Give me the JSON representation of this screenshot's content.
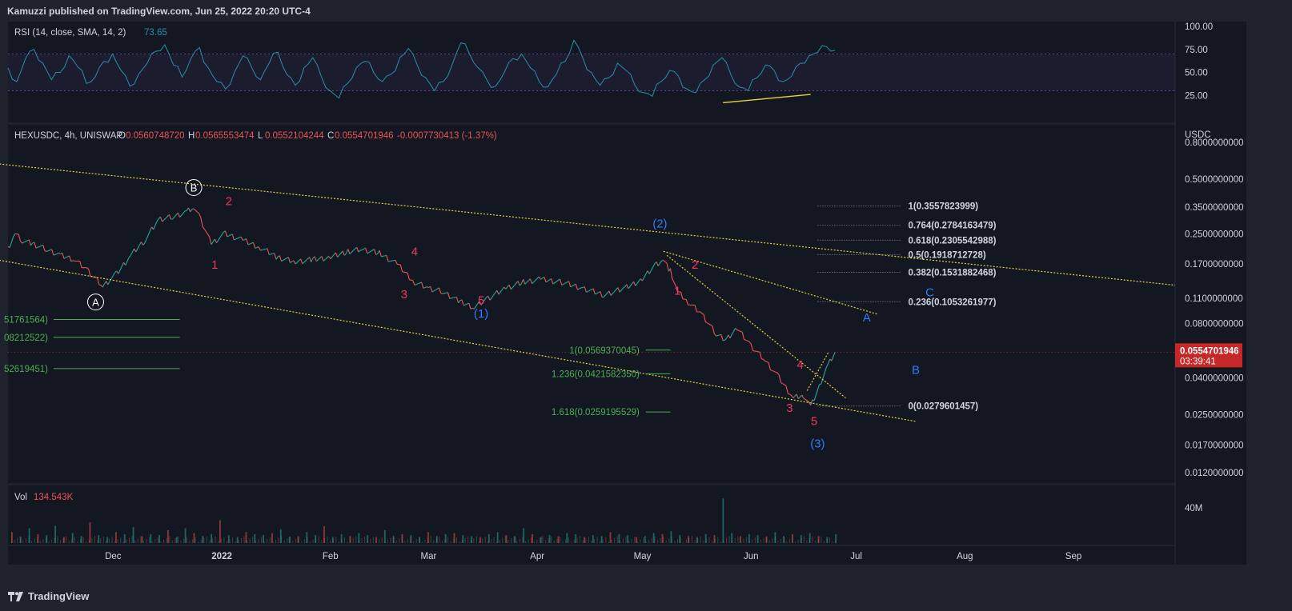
{
  "header": {
    "publisher_line": "Kamuzzi published on TradingView.com, Jun 25, 2022 20:20 UTC-4"
  },
  "footer": {
    "brand": "TradingView",
    "logo_icon": "tradingview-logo-icon"
  },
  "colors": {
    "background": "#131722",
    "frame": "#1e222d",
    "text": "#d1d4dc",
    "rsi_line": "#2a8fa8",
    "fib_green": "#4caf50",
    "wave_red": "#f23661",
    "wave_blue": "#2f7cf6",
    "trend_yellow": "#e8d237",
    "price_badge": "#c62828",
    "vol_up": "#26a69a",
    "vol_down": "#ef5350"
  },
  "rsi_panel": {
    "legend_name": "RSI (14, close, SMA, 14, 2)",
    "legend_value": "73.65",
    "axis_labels": [
      "100.00",
      "75.00",
      "50.00",
      "25.00"
    ]
  },
  "price_panel": {
    "legend": {
      "symbol": "HEXUSDC, 4h, UNISWAP",
      "o_label": "O",
      "o_value": "0.0560748720",
      "h_label": "H",
      "h_value": "0.0565553474",
      "l_label": "L",
      "l_value": "0.0552104244",
      "c_label": "C",
      "c_value": "0.0554701946",
      "change": "-0.0007730413 (-1.37%)"
    },
    "currency": "USDC",
    "axis_labels": [
      "0.8000000000",
      "0.5000000000",
      "0.3500000000",
      "0.2500000000",
      "0.1700000000",
      "0.1100000000",
      "0.0800000000",
      "0.0400000000",
      "0.0250000000",
      "0.0170000000",
      "0.0120000000"
    ],
    "price_badge": {
      "price": "0.0554701946",
      "countdown": "03:39:41"
    },
    "fib_right": [
      "1(0.3557823999)",
      "0.764(0.2784163479)",
      "0.618(0.2305542988)",
      "0.5(0.1918712728)",
      "0.382(0.1531882468)",
      "0.236(0.1053261977)",
      "0(0.0279601457)"
    ],
    "fib_mid": [
      "1(0.0569370045)",
      "1.236(0.0421582350)",
      "1.618(0.0259195529)"
    ],
    "fib_left": [
      "51761564)",
      "08212522)",
      "52619451)"
    ],
    "wave_labels_circled": [
      "B",
      "A"
    ],
    "wave_labels_red": [
      "2",
      "1",
      "4",
      "3",
      "5",
      "2",
      "1",
      "4",
      "3",
      "5"
    ],
    "wave_labels_blue": [
      "(1)",
      "(2)",
      "(3)",
      "A",
      "B",
      "C"
    ]
  },
  "volume_panel": {
    "legend_name": "Vol",
    "legend_value": "134.543K",
    "axis_label": "40M"
  },
  "time_axis": [
    "Dec",
    "2022",
    "Feb",
    "Mar",
    "Apr",
    "May",
    "Jun",
    "Jul",
    "Aug",
    "Sep"
  ],
  "chart_data": {
    "type": "line",
    "title": "HEXUSDC, 4h, UNISWAP",
    "ylabel": "USDC",
    "y_scale": "log",
    "ylim": [
      0.0105,
      1.0
    ],
    "x_range": [
      "2021-11-01",
      "2022-09-30"
    ],
    "last_close": 0.0554701946,
    "price_path": [
      {
        "date": "2021-11-01",
        "value": 0.205
      },
      {
        "date": "2021-11-03",
        "value": 0.25
      },
      {
        "date": "2021-11-05",
        "value": 0.23
      },
      {
        "date": "2021-11-08",
        "value": 0.22
      },
      {
        "date": "2021-11-12",
        "value": 0.205
      },
      {
        "date": "2021-11-16",
        "value": 0.19
      },
      {
        "date": "2021-11-20",
        "value": 0.18
      },
      {
        "date": "2021-11-24",
        "value": 0.155
      },
      {
        "date": "2021-11-28",
        "value": 0.128
      },
      {
        "date": "2021-12-02",
        "value": 0.15
      },
      {
        "date": "2021-12-06",
        "value": 0.19
      },
      {
        "date": "2021-12-10",
        "value": 0.23
      },
      {
        "date": "2021-12-14",
        "value": 0.3
      },
      {
        "date": "2021-12-18",
        "value": 0.31
      },
      {
        "date": "2021-12-22",
        "value": 0.33
      },
      {
        "date": "2021-12-24",
        "value": 0.35
      },
      {
        "date": "2021-12-26",
        "value": 0.3
      },
      {
        "date": "2021-12-29",
        "value": 0.22
      },
      {
        "date": "2022-01-02",
        "value": 0.25
      },
      {
        "date": "2022-01-07",
        "value": 0.23
      },
      {
        "date": "2022-01-12",
        "value": 0.21
      },
      {
        "date": "2022-01-17",
        "value": 0.185
      },
      {
        "date": "2022-01-22",
        "value": 0.175
      },
      {
        "date": "2022-01-27",
        "value": 0.18
      },
      {
        "date": "2022-02-01",
        "value": 0.185
      },
      {
        "date": "2022-02-06",
        "value": 0.2
      },
      {
        "date": "2022-02-10",
        "value": 0.205
      },
      {
        "date": "2022-02-15",
        "value": 0.195
      },
      {
        "date": "2022-02-20",
        "value": 0.17
      },
      {
        "date": "2022-02-25",
        "value": 0.135
      },
      {
        "date": "2022-03-01",
        "value": 0.125
      },
      {
        "date": "2022-03-05",
        "value": 0.12
      },
      {
        "date": "2022-03-10",
        "value": 0.105
      },
      {
        "date": "2022-03-14",
        "value": 0.098
      },
      {
        "date": "2022-03-18",
        "value": 0.11
      },
      {
        "date": "2022-03-23",
        "value": 0.125
      },
      {
        "date": "2022-03-28",
        "value": 0.135
      },
      {
        "date": "2022-04-02",
        "value": 0.14
      },
      {
        "date": "2022-04-08",
        "value": 0.135
      },
      {
        "date": "2022-04-14",
        "value": 0.125
      },
      {
        "date": "2022-04-20",
        "value": 0.115
      },
      {
        "date": "2022-04-26",
        "value": 0.125
      },
      {
        "date": "2022-05-01",
        "value": 0.14
      },
      {
        "date": "2022-05-05",
        "value": 0.17
      },
      {
        "date": "2022-05-07",
        "value": 0.18
      },
      {
        "date": "2022-05-09",
        "value": 0.155
      },
      {
        "date": "2022-05-11",
        "value": 0.12
      },
      {
        "date": "2022-05-14",
        "value": 0.105
      },
      {
        "date": "2022-05-18",
        "value": 0.09
      },
      {
        "date": "2022-05-22",
        "value": 0.07
      },
      {
        "date": "2022-05-25",
        "value": 0.065
      },
      {
        "date": "2022-05-28",
        "value": 0.075
      },
      {
        "date": "2022-06-01",
        "value": 0.06
      },
      {
        "date": "2022-06-05",
        "value": 0.05
      },
      {
        "date": "2022-06-09",
        "value": 0.04
      },
      {
        "date": "2022-06-13",
        "value": 0.031
      },
      {
        "date": "2022-06-16",
        "value": 0.032
      },
      {
        "date": "2022-06-18",
        "value": 0.028
      },
      {
        "date": "2022-06-21",
        "value": 0.038
      },
      {
        "date": "2022-06-23",
        "value": 0.047
      },
      {
        "date": "2022-06-25",
        "value": 0.0554701946
      }
    ],
    "rsi": {
      "ylim": [
        0,
        100
      ],
      "values": [
        55,
        40,
        65,
        75,
        60,
        42,
        50,
        68,
        56,
        38,
        45,
        62,
        70,
        52,
        35,
        48,
        60,
        73,
        80,
        58,
        45,
        65,
        77,
        55,
        40,
        32,
        50,
        68,
        55,
        42,
        60,
        72,
        48,
        36,
        55,
        66,
        45,
        30,
        22,
        38,
        55,
        62,
        50,
        40,
        48,
        66,
        76,
        58,
        44,
        30,
        40,
        58,
        82,
        70,
        55,
        42,
        35,
        50,
        65,
        70,
        55,
        40,
        34,
        48,
        62,
        85,
        66,
        50,
        36,
        44,
        60,
        52,
        36,
        28,
        24,
        40,
        52,
        46,
        32,
        28,
        42,
        58,
        66,
        48,
        34,
        30,
        44,
        58,
        52,
        40,
        46,
        60,
        68,
        72,
        78,
        74
      ]
    },
    "volume": {
      "ylim": [
        0,
        80000000
      ],
      "bars": [
        0.22,
        0.12,
        0.3,
        0.18,
        0.16,
        0.35,
        0.12,
        0.2,
        0.14,
        0.42,
        0.16,
        0.12,
        0.22,
        0.18,
        0.32,
        0.14,
        0.18,
        0.16,
        0.26,
        0.12,
        0.3,
        0.2,
        0.14,
        0.18,
        0.46,
        0.16,
        0.12,
        0.22,
        0.18,
        0.16,
        0.2,
        0.28,
        0.12,
        0.14,
        0.22,
        0.16,
        0.34,
        0.12,
        0.18,
        0.14,
        0.2,
        0.16,
        0.12,
        0.26,
        0.14,
        0.18,
        0.16,
        0.12,
        0.22,
        0.14,
        0.18,
        0.2,
        0.16,
        0.14,
        0.12,
        0.18,
        0.22,
        0.16,
        0.14,
        0.3,
        0.18,
        0.12,
        0.16,
        0.14,
        0.2,
        0.18,
        0.12,
        0.16,
        0.14,
        0.22,
        0.18,
        0.16,
        0.12,
        0.14,
        0.2,
        0.18,
        0.24,
        0.16,
        0.14,
        0.12,
        0.18,
        0.16,
        0.9,
        0.2,
        0.14,
        0.18,
        0.16,
        0.12,
        0.22,
        0.14,
        0.18,
        0.16,
        0.2,
        0.14,
        0.12,
        0.18
      ]
    }
  }
}
